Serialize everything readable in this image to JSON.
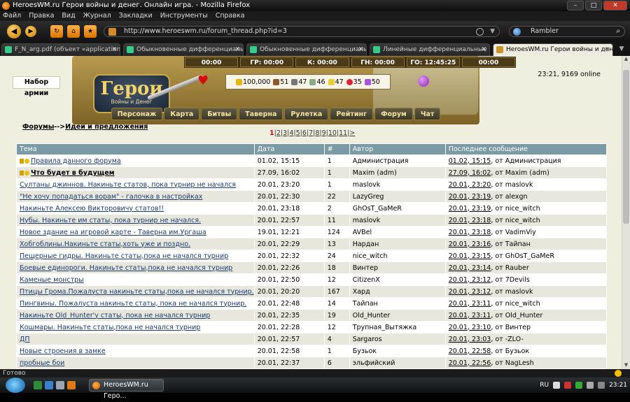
{
  "window": {
    "title": "HeroesWM.ru Герои войны и денег. Онлайн игра. - Mozilla Firefox"
  },
  "menu": [
    "Файл",
    "Правка",
    "Вид",
    "Журнал",
    "Закладки",
    "Инструменты",
    "Справка"
  ],
  "address": {
    "url": "http://www.heroeswm.ru/forum_thread.php?id=3"
  },
  "search": {
    "engine": "Rambler"
  },
  "tabs": [
    "F_N_arg.pdf (объект «application/...",
    "Обыкновенные дифференциаль...",
    "Обыкновенные дифференциаль...",
    "Линейные дифференциальные у...",
    "HeroesWM.ru Герои войны и ден..."
  ],
  "game": {
    "army_button": "Набор армии",
    "timers": [
      "00:00",
      "ГР: 00:00",
      "К: 00:00",
      "ГН: 00:00",
      "ГО: 12:45:25",
      "00:00"
    ],
    "logo_title": "Герои",
    "logo_sub": "Войны и Денег",
    "resources": {
      "gold": "100,000",
      "wood": "51",
      "ore": "47",
      "mercury": "46",
      "sulfur": "47",
      "crystals": "35",
      "gems": "50"
    },
    "online": "23:21, 9169 online",
    "nav": [
      "Персонаж",
      "Карта",
      "Битвы",
      "Таверна",
      "Рулетка",
      "Рейтинг",
      "Форум",
      "Чат"
    ]
  },
  "breadcrumb": {
    "forums": "Форумы",
    "sep": "-->",
    "section": "Идеи и предложения"
  },
  "pagination": {
    "current": "1",
    "pages": [
      "2",
      "3",
      "4",
      "5",
      "6",
      "7",
      "8",
      "9",
      "10",
      "11"
    ],
    "next": ">"
  },
  "table": {
    "headers": [
      "Тема",
      "Дата",
      "#",
      "Автор",
      "Последнее сообщение"
    ],
    "rows": [
      {
        "topic": "Правила данного форума",
        "date": "01.02, 15:15",
        "count": "1",
        "author": "Администрация",
        "last_date": "01.02, 15:15",
        "last_by": ", от Администрация",
        "lock": true,
        "bold": false
      },
      {
        "topic": "Что будет в будущем",
        "date": "27.09, 16:02",
        "count": "1",
        "author": "Maxim (adm)",
        "last_date": "27.09, 16:02",
        "last_by": ", от Maxim (adm)",
        "lock": true,
        "bold": true
      },
      {
        "topic": "Султаны джиннов. Накиньте статов, пока турнир не начался",
        "date": "20.01, 23:20",
        "count": "1",
        "author": "maslovk",
        "last_date": "20.01, 23:20",
        "last_by": ", от maslovk"
      },
      {
        "topic": "\"Не хочу попадаться ворам\" - галочка в настройках",
        "date": "20.01, 22:30",
        "count": "22",
        "author": "LazyGreg",
        "last_date": "20.01, 23:19",
        "last_by": ", от alexgn"
      },
      {
        "topic": "Накиньте Алексею  Викторовичу статов!!",
        "date": "20.01, 23:18",
        "count": "2",
        "author": "GhOsT_GaMeR",
        "last_date": "20.01, 23:19",
        "last_by": ", от nice_witch"
      },
      {
        "topic": "Нубы. Накиньте им статы, пока турнир не начался.",
        "date": "20.01, 22:57",
        "count": "11",
        "author": "maslovk",
        "last_date": "20.01, 23:18",
        "last_by": ", от nice_witch"
      },
      {
        "topic": "Новое здание на игровой карте - Таверна им.Ургаша",
        "date": "19.01, 12:21",
        "count": "124",
        "author": "AVBel",
        "last_date": "20.01, 23:18",
        "last_by": ", от VadimViy"
      },
      {
        "topic": "Хобгоблины.Накиньте статы,хоть уже и поздно.",
        "date": "20.01, 22:29",
        "count": "13",
        "author": "Нардан",
        "last_date": "20.01, 23:16",
        "last_by": ", от Тайпан"
      },
      {
        "topic": "Пещерные гидры. Накиньте статы,пока не начался турнир",
        "date": "20.01, 22:32",
        "count": "24",
        "author": "nice_witch",
        "last_date": "20.01, 23:15",
        "last_by": ", от GhOsT_GaMeR"
      },
      {
        "topic": "Боевые единороги. Накиньте статы,пока не начался турнир",
        "date": "20.01, 22:26",
        "count": "18",
        "author": "Винтер",
        "last_date": "20.01, 23:14",
        "last_by": ", от Rauber"
      },
      {
        "topic": "Каменые монстры",
        "date": "20.01, 22:50",
        "count": "12",
        "author": "CitizenX",
        "last_date": "20.01, 23:12",
        "last_by": ", от 7Devils"
      },
      {
        "topic": "Птицы Грома.Пожалуста накиньте статы,пока не начался турнир.",
        "date": "20.01, 20:20",
        "count": "167",
        "author": "Хард",
        "last_date": "20.01, 23:12",
        "last_by": ", от maslovk"
      },
      {
        "topic": "Пингвины. Пожалуста накиньте статы, пока не начался турнир.",
        "date": "20.01, 22:48",
        "count": "14",
        "author": "Тайпан",
        "last_date": "20.01, 23:11",
        "last_by": ", от nice_witch"
      },
      {
        "topic": "Накиньте Old_Hunter'у статы, пока не начался турнир",
        "date": "20.01, 22:35",
        "count": "19",
        "author": "Old_Hunter",
        "last_date": "20.01, 23:11",
        "last_by": ", от Old_Hunter"
      },
      {
        "topic": "Кошмары. Накиньте статы,пока не начался турнир",
        "date": "20.01, 22:28",
        "count": "12",
        "author": "Трупная_Вытяжка",
        "last_date": "20.01, 23:10",
        "last_by": ", от Винтер"
      },
      {
        "topic": "ДП",
        "date": "20.01, 22:57",
        "count": "4",
        "author": "Sargaros",
        "last_date": "20.01, 23:03",
        "last_by": ", от -ZLO-"
      },
      {
        "topic": "Новые строения в замке",
        "date": "20.01, 22:58",
        "count": "1",
        "author": "Бузьок",
        "last_date": "20.01, 22:58",
        "last_by": ", от Бузьок"
      },
      {
        "topic": "пробные бои",
        "date": "20.01, 22:37",
        "count": "6",
        "author": "эльфийский",
        "last_date": "20.01, 22:56",
        "last_by": ", от NagLesh"
      }
    ]
  },
  "status": {
    "text": "Готово"
  },
  "taskbar": {
    "window_button": "HeroesWM.ru Геро...",
    "lang": "RU",
    "time": "23:21"
  }
}
